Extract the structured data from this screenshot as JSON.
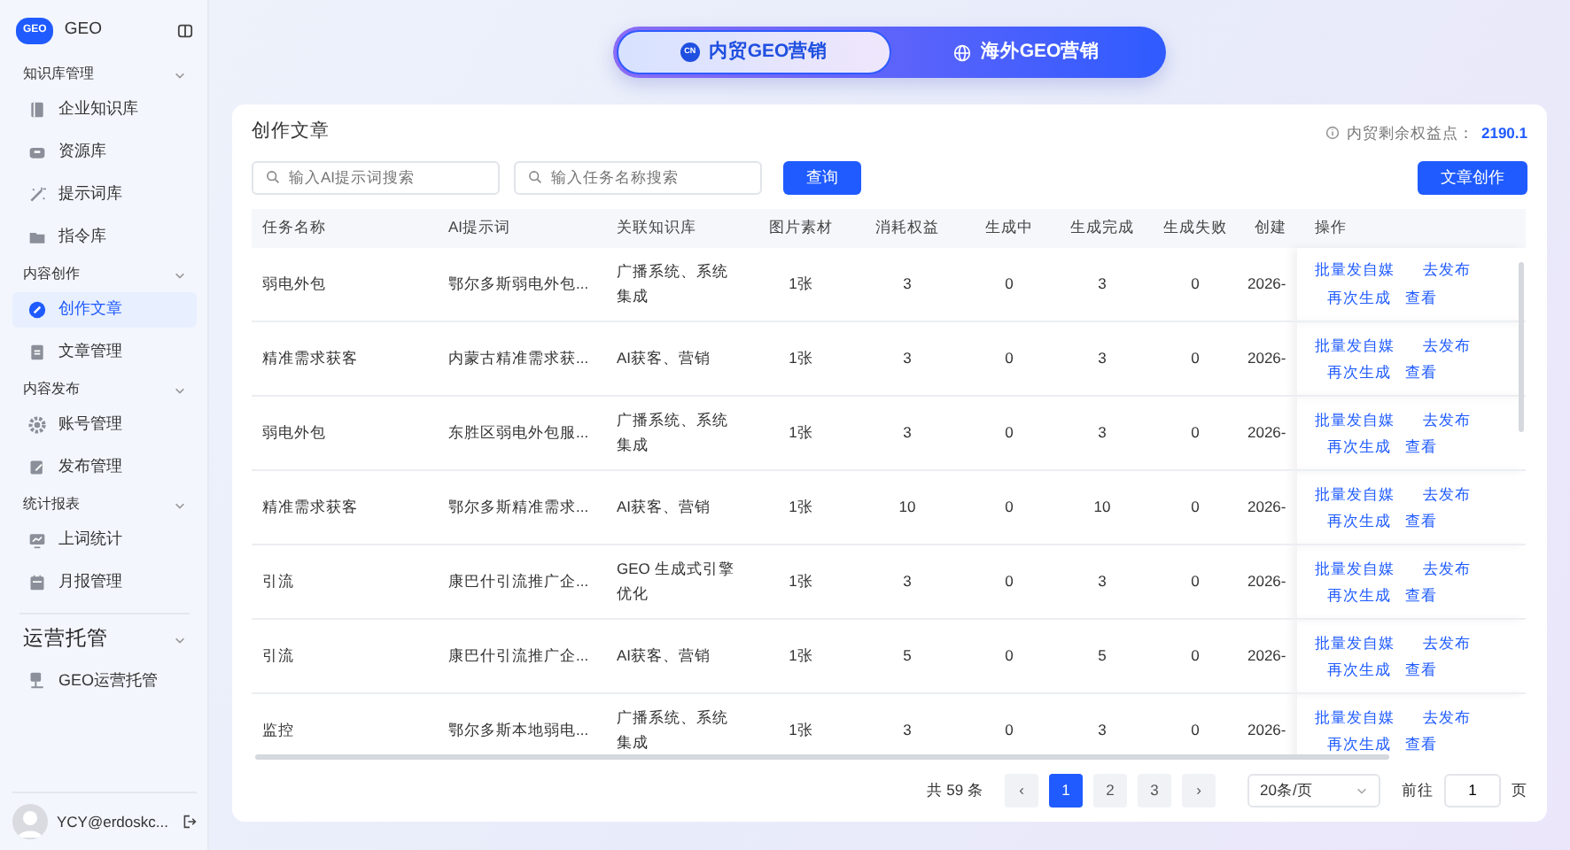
{
  "sidebar": {
    "logo_badge": "GEO",
    "logo_text": "GEO",
    "groups": [
      {
        "title": "知识库管理",
        "expanded": true,
        "items": [
          {
            "label": "企业知识库",
            "selected": false
          },
          {
            "label": "资源库",
            "selected": false
          },
          {
            "label": "提示词库",
            "selected": false
          },
          {
            "label": "指令库",
            "selected": false
          }
        ]
      },
      {
        "title": "内容创作",
        "expanded": true,
        "items": [
          {
            "label": "创作文章",
            "selected": true
          },
          {
            "label": "文章管理",
            "selected": false
          }
        ]
      },
      {
        "title": "内容发布",
        "expanded": true,
        "items": [
          {
            "label": "账号管理",
            "selected": false
          },
          {
            "label": "发布管理",
            "selected": false
          }
        ]
      },
      {
        "title": "统计报表",
        "expanded": true,
        "items": [
          {
            "label": "上词统计",
            "selected": false
          },
          {
            "label": "月报管理",
            "selected": false
          }
        ]
      }
    ],
    "ops_group": {
      "title": "运营托管",
      "expanded": true,
      "items": [
        {
          "label": "GEO运营托管",
          "selected": false
        }
      ]
    },
    "user": {
      "name": "YCY@erdoskc..."
    }
  },
  "mode_tabs": [
    {
      "label": "内贸GEO营销",
      "badge": "CN",
      "selected": true
    },
    {
      "label": "海外GEO营销",
      "selected": false
    }
  ],
  "card": {
    "title": "创作文章",
    "quota_label": "内贸剩余权益点：",
    "quota_value": "2190.1",
    "search_fields": [
      {
        "placeholder": "输入AI提示词搜索"
      },
      {
        "placeholder": "输入任务名称搜索"
      }
    ],
    "query_button": "查询",
    "create_button": "文章创作"
  },
  "table": {
    "columns": [
      "任务名称",
      "AI提示词",
      "关联知识库",
      "图片素材",
      "消耗权益",
      "生成中",
      "生成完成",
      "生成失败",
      "创建",
      "操作"
    ],
    "rows": [
      {
        "cells": [
          "弱电外包",
          "鄂尔多斯弱电外包...",
          "广播系统、系统集成",
          "1张",
          "3",
          "0",
          "3",
          "0",
          "2026-"
        ],
        "actions": [
          "批量发自媒",
          "去发布",
          "再次生成",
          "查看"
        ]
      },
      {
        "cells": [
          "精准需求获客",
          "内蒙古精准需求获...",
          "AI获客、营销",
          "1张",
          "3",
          "0",
          "3",
          "0",
          "2026-"
        ],
        "actions": [
          "批量发自媒",
          "去发布",
          "再次生成",
          "查看"
        ]
      },
      {
        "cells": [
          "弱电外包",
          "东胜区弱电外包服...",
          "广播系统、系统集成",
          "1张",
          "3",
          "0",
          "3",
          "0",
          "2026-"
        ],
        "actions": [
          "批量发自媒",
          "去发布",
          "再次生成",
          "查看"
        ]
      },
      {
        "cells": [
          "精准需求获客",
          "鄂尔多斯精准需求...",
          "AI获客、营销",
          "1张",
          "10",
          "0",
          "10",
          "0",
          "2026-"
        ],
        "actions": [
          "批量发自媒",
          "去发布",
          "再次生成",
          "查看"
        ]
      },
      {
        "cells": [
          "引流",
          "康巴什引流推广企...",
          "GEO 生成式引擎优化",
          "1张",
          "3",
          "0",
          "3",
          "0",
          "2026-"
        ],
        "actions": [
          "批量发自媒",
          "去发布",
          "再次生成",
          "查看"
        ]
      },
      {
        "cells": [
          "引流",
          "康巴什引流推广企...",
          "AI获客、营销",
          "1张",
          "5",
          "0",
          "5",
          "0",
          "2026-"
        ],
        "actions": [
          "批量发自媒",
          "去发布",
          "再次生成",
          "查看"
        ]
      },
      {
        "cells": [
          "监控",
          "鄂尔多斯本地弱电...",
          "广播系统、系统集成",
          "1张",
          "3",
          "0",
          "3",
          "0",
          "2026-"
        ],
        "actions": [
          "批量发自媒",
          "去发布",
          "再次生成",
          "查看"
        ]
      }
    ]
  },
  "pagination": {
    "total": "共 59 条",
    "prev": "‹",
    "pages": [
      {
        "label": "1",
        "selected": true
      },
      {
        "label": "2",
        "selected": false
      },
      {
        "label": "3",
        "selected": false
      }
    ],
    "next": "›",
    "page_size": "20条/页",
    "goto_label": "前往",
    "goto_value": "1",
    "goto_unit": "页"
  }
}
